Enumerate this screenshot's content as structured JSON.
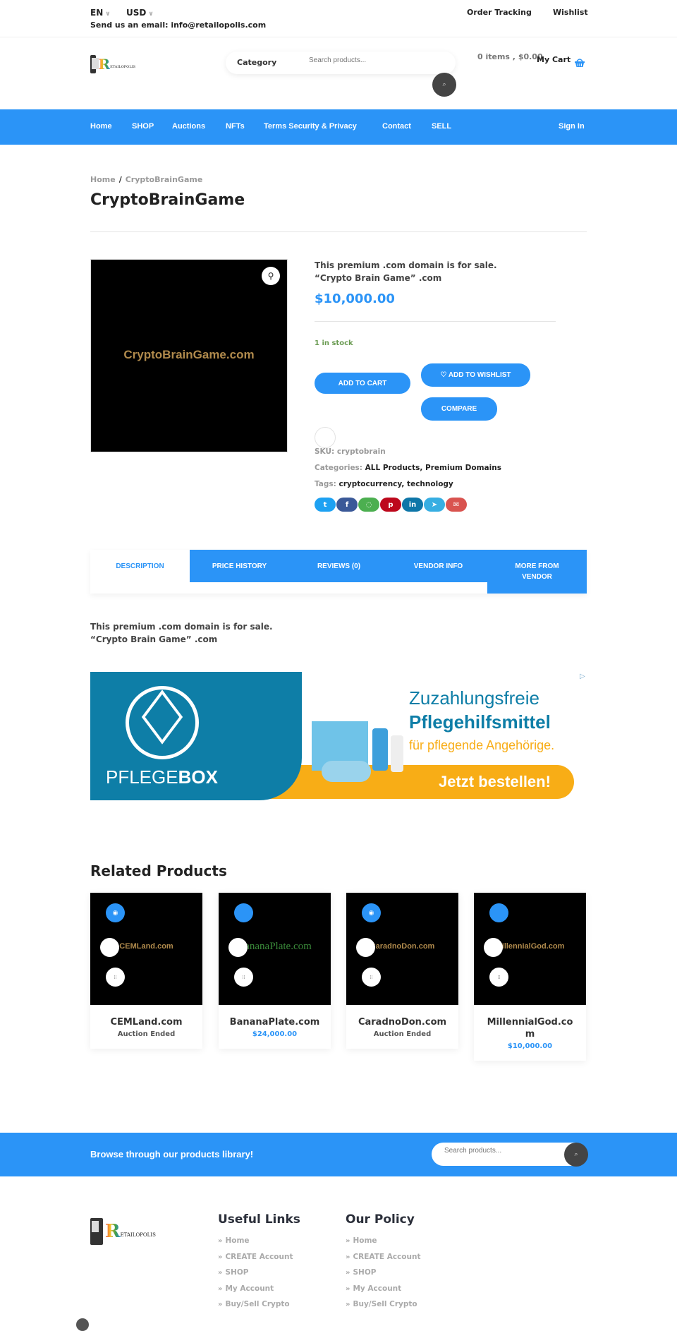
{
  "topbar": {
    "language": "EN",
    "currency": "USD",
    "email_line": "Send us an email: info@retailopolis.com",
    "links": [
      "Order Tracking",
      "Wishlist"
    ]
  },
  "header": {
    "logo_letter": "R",
    "logo_text": "ETAILOPOLIS",
    "category_label": "Category",
    "search_placeholder": "Search products...",
    "search_button_glyph": "⌕",
    "cart_info": "0 items , $0.00",
    "cart_label": "My Cart"
  },
  "nav": {
    "items": [
      "Home",
      "SHOP",
      "Auctions",
      "NFTs",
      "Terms Security & Privacy",
      "Contact",
      "SELL"
    ],
    "sign_in": "Sign In"
  },
  "breadcrumb": {
    "home": "Home",
    "separator": "/",
    "current": "CryptoBrainGame"
  },
  "page_title": "CryptoBrainGame",
  "product": {
    "image_text": "CryptoBrainGame.com",
    "short_desc_line1": "This premium .com domain is for sale.",
    "short_desc_line2": "“Crypto Brain Game” .com",
    "price": "$10,000.00",
    "stock": "1 in stock",
    "add_to_cart": "ADD TO CART",
    "add_to_wishlist": "♡ ADD TO WISHLIST",
    "compare": "COMPARE",
    "sku_label": "SKU:",
    "sku": "cryptobrain",
    "categories_label": "Categories:",
    "categories": "ALL Products, Premium Domains",
    "tags_label": "Tags:",
    "tags": "cryptocurrency, technology",
    "share": [
      {
        "name": "twitter",
        "glyph": "t",
        "color": "#1da1f2"
      },
      {
        "name": "facebook",
        "glyph": "f",
        "color": "#3b5998"
      },
      {
        "name": "whatsapp",
        "glyph": "◌",
        "color": "#4caf50"
      },
      {
        "name": "pinterest",
        "glyph": "p",
        "color": "#bd081c"
      },
      {
        "name": "linkedin",
        "glyph": "in",
        "color": "#0e76a8"
      },
      {
        "name": "telegram",
        "glyph": "➤",
        "color": "#37aee2"
      },
      {
        "name": "email",
        "glyph": "✉",
        "color": "#d9534f"
      }
    ]
  },
  "tabs": [
    "DESCRIPTION",
    "PRICE HISTORY",
    "REVIEWS (0)",
    "VENDOR INFO",
    "MORE FROM VENDOR"
  ],
  "description": {
    "line1": "This premium .com domain is for sale.",
    "line2": "“Crypto Brain Game” .com"
  },
  "ad": {
    "brand_light": "PFLEGE",
    "brand_bold": "BOX",
    "headline1": "Zuzahlungsfreie",
    "headline2": "Pflegehilfsmittel",
    "subline": "für pflegende Angehörige.",
    "cta": "Jetzt bestellen!",
    "adchoices_glyph": "▷"
  },
  "related": {
    "title": "Related Products",
    "items": [
      {
        "image_text": "CEMLand.com",
        "name": "CEMLand.com",
        "status": "Auction Ended",
        "is_price": false
      },
      {
        "image_text": "BananaPlate.com",
        "name": "BananaPlate.com",
        "status": "$24,000.00",
        "is_price": true
      },
      {
        "image_text": "CaradnoDon.com",
        "name": "CaradnoDon.com",
        "status": "Auction Ended",
        "is_price": false
      },
      {
        "image_text": "MillennialGod.com",
        "name": "MillennialGod.com",
        "status": "$10,000.00",
        "is_price": true
      }
    ]
  },
  "browse": {
    "text": "Browse through our products library!",
    "search_placeholder": "Search products..."
  },
  "footer": {
    "useful_links": {
      "title": "Useful Links",
      "items": [
        "Home",
        "CREATE Account",
        "SHOP",
        "My Account",
        "Buy/Sell Crypto"
      ]
    },
    "our_policy": {
      "title": "Our Policy",
      "items": [
        "Home",
        "CREATE Account",
        "SHOP",
        "My Account",
        "Buy/Sell Crypto"
      ]
    }
  },
  "colors": {
    "accent": "#2b94f7",
    "stock_green": "#6a9b52",
    "image_gold": "#b08a4c"
  }
}
